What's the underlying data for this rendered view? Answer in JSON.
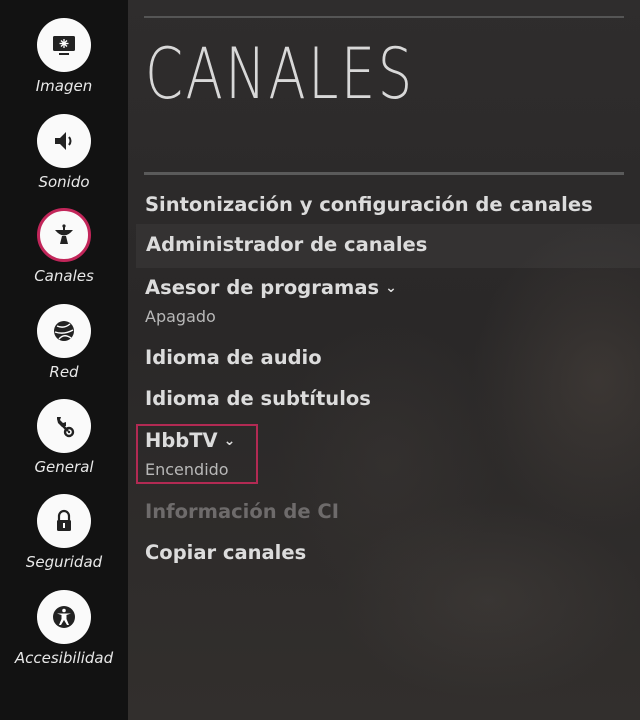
{
  "sidebar": {
    "items": [
      {
        "label": "Imagen",
        "icon": "picture-icon"
      },
      {
        "label": "Sonido",
        "icon": "speaker-icon"
      },
      {
        "label": "Canales",
        "icon": "satellite-dish-icon",
        "active": true
      },
      {
        "label": "Red",
        "icon": "globe-icon"
      },
      {
        "label": "General",
        "icon": "settings-tools-icon"
      },
      {
        "label": "Seguridad",
        "icon": "lock-icon"
      },
      {
        "label": "Accesibilidad",
        "icon": "accessibility-icon"
      }
    ]
  },
  "main": {
    "title": "CANALES",
    "menu": [
      {
        "label": "Sintonización y configuración de canales"
      },
      {
        "label": "Administrador de canales"
      },
      {
        "label": "Asesor de programas",
        "value": "Apagado",
        "chevron": "⌄"
      },
      {
        "label": "Idioma de audio"
      },
      {
        "label": "Idioma de subtítulos"
      },
      {
        "label": "HbbTV",
        "value": "Encendido",
        "chevron": "⌄"
      },
      {
        "label": "Información de CI",
        "disabled": true
      },
      {
        "label": "Copiar canales"
      }
    ]
  },
  "colors": {
    "accent": "#c2265a",
    "sidebar_bg": "#121212",
    "text": "#dcdcdc",
    "disabled_text": "#6e6b6b"
  }
}
